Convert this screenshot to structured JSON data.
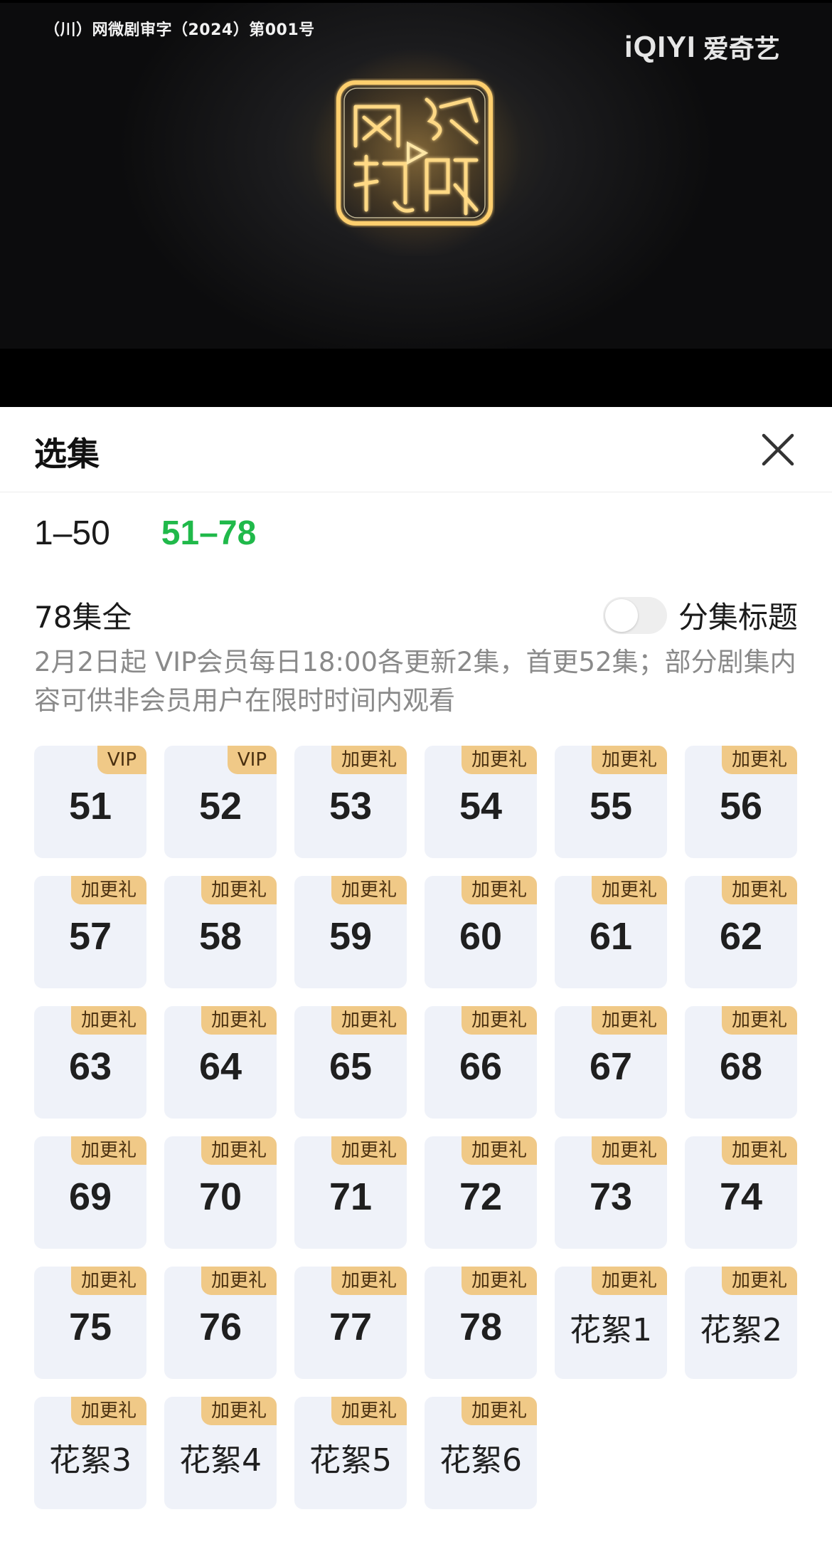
{
  "video": {
    "license_text": "（川）网微剧审字（2024）第001号",
    "brand_mark": "iQIYI",
    "brand_cn": "爱奇艺",
    "seal_chars": [
      "网",
      "络",
      "视",
      "听"
    ]
  },
  "panel": {
    "title": "选集",
    "close_icon": "close-icon",
    "range_tabs": [
      {
        "label": "1–50",
        "active": false
      },
      {
        "label": "51–78",
        "active": true
      }
    ],
    "total_label": "78集全",
    "episode_title_toggle": {
      "label": "分集标题",
      "on": false
    },
    "schedule_text": "2月2日起 VIP会员每日18:00各更新2集，首更52集；部分剧集内容可供非会员用户在限时时间内观看"
  },
  "episodes": [
    {
      "label": "51",
      "badge": "VIP"
    },
    {
      "label": "52",
      "badge": "VIP"
    },
    {
      "label": "53",
      "badge": "加更礼"
    },
    {
      "label": "54",
      "badge": "加更礼"
    },
    {
      "label": "55",
      "badge": "加更礼"
    },
    {
      "label": "56",
      "badge": "加更礼"
    },
    {
      "label": "57",
      "badge": "加更礼"
    },
    {
      "label": "58",
      "badge": "加更礼"
    },
    {
      "label": "59",
      "badge": "加更礼"
    },
    {
      "label": "60",
      "badge": "加更礼"
    },
    {
      "label": "61",
      "badge": "加更礼"
    },
    {
      "label": "62",
      "badge": "加更礼"
    },
    {
      "label": "63",
      "badge": "加更礼"
    },
    {
      "label": "64",
      "badge": "加更礼"
    },
    {
      "label": "65",
      "badge": "加更礼"
    },
    {
      "label": "66",
      "badge": "加更礼"
    },
    {
      "label": "67",
      "badge": "加更礼"
    },
    {
      "label": "68",
      "badge": "加更礼"
    },
    {
      "label": "69",
      "badge": "加更礼"
    },
    {
      "label": "70",
      "badge": "加更礼"
    },
    {
      "label": "71",
      "badge": "加更礼"
    },
    {
      "label": "72",
      "badge": "加更礼"
    },
    {
      "label": "73",
      "badge": "加更礼"
    },
    {
      "label": "74",
      "badge": "加更礼"
    },
    {
      "label": "75",
      "badge": "加更礼"
    },
    {
      "label": "76",
      "badge": "加更礼"
    },
    {
      "label": "77",
      "badge": "加更礼"
    },
    {
      "label": "78",
      "badge": "加更礼"
    },
    {
      "label": "花絮1",
      "badge": "加更礼"
    },
    {
      "label": "花絮2",
      "badge": "加更礼"
    },
    {
      "label": "花絮3",
      "badge": "加更礼"
    },
    {
      "label": "花絮4",
      "badge": "加更礼"
    },
    {
      "label": "花絮5",
      "badge": "加更礼"
    },
    {
      "label": "花絮6",
      "badge": "加更礼"
    }
  ],
  "colors": {
    "accent_green": "#20b94a",
    "badge_gold": "#f0c987",
    "tile_bg": "#eff2f9"
  }
}
